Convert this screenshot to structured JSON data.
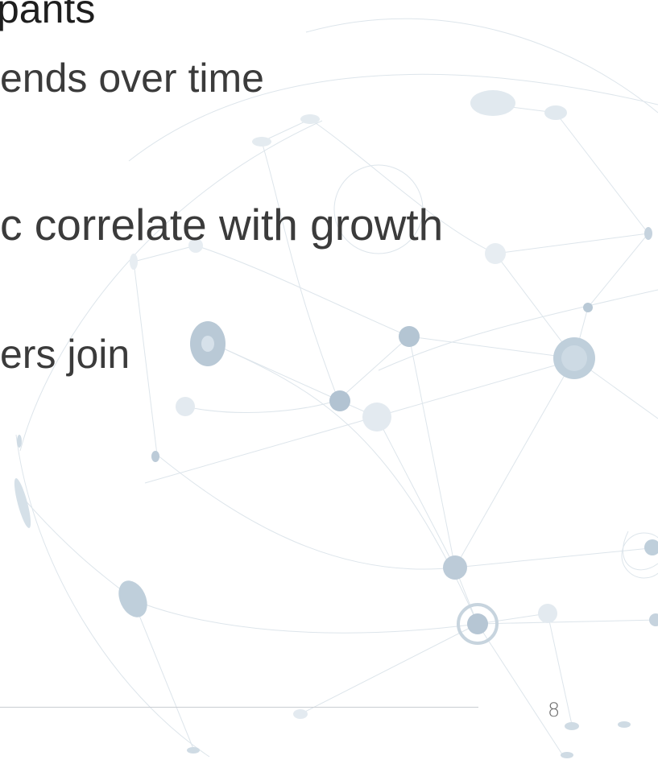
{
  "slide": {
    "lines": [
      "pants",
      "ends over time",
      "c correlate with growth",
      "ers join"
    ],
    "page_number": "8"
  },
  "colors": {
    "text": "#3b3b3b",
    "node": "#b6c7d5",
    "edge": "#dce4ea",
    "rule": "#c9cdd2"
  }
}
